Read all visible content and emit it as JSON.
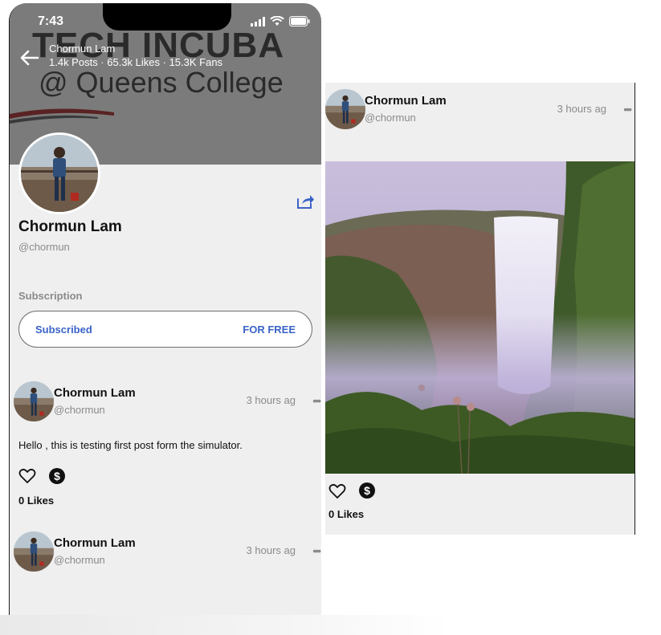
{
  "status_bar": {
    "time": "7:43"
  },
  "header": {
    "name": "Chormun Lam",
    "stats": "1.4k Posts · 65.3k Likes · 15.3K Fans"
  },
  "cover": {
    "line1": "TECH INCUBA",
    "line2": "@ Queens College"
  },
  "profile": {
    "name": "Chormun Lam",
    "handle": "@chormun"
  },
  "subscription": {
    "label": "Subscription",
    "status": "Subscribed",
    "price": "FOR FREE"
  },
  "posts": [
    {
      "author": "Chormun Lam",
      "handle": "@chormun",
      "time": "3 hours ag",
      "more": "•••",
      "text": "Hello , this is testing first post form the simulator.",
      "likes": "0 Likes"
    },
    {
      "author": "Chormun Lam",
      "handle": "@chormun",
      "time": "3 hours ag",
      "more": "•••"
    }
  ],
  "right_post": {
    "author": "Chormun Lam",
    "handle": "@chormun",
    "time": "3 hours ag",
    "more": "•••",
    "likes": "0 Likes"
  },
  "icons": {
    "back": "arrow-left-icon",
    "share": "share-icon",
    "like": "heart-icon",
    "tip": "dollar-icon",
    "more": "ellipsis-icon",
    "wifi": "wifi-icon",
    "battery": "battery-icon",
    "signal": "signal-icon"
  },
  "colors": {
    "accent": "#3a63c8",
    "background": "#efefef",
    "cover_overlay": "#7b7b7b"
  }
}
